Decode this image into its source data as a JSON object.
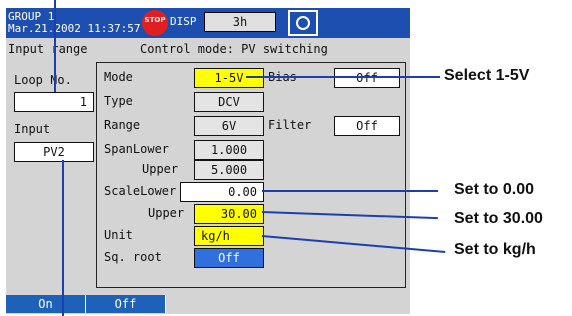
{
  "header": {
    "group": "GROUP 1",
    "datetime": "Mar.21.2002 11:37:57",
    "stop_label": "STOP",
    "disp_label": "DISP",
    "time_span": "3h"
  },
  "page": {
    "title": "Input range",
    "mode_text": "Control mode: PV switching"
  },
  "left_panel": {
    "loop_label": "Loop No.",
    "loop_value": "1",
    "input_label": "Input",
    "input_value": "PV2"
  },
  "fields": {
    "mode_label": "Mode",
    "mode_value": "1-5V",
    "bias_label": "Bias",
    "bias_value": "Off",
    "type_label": "Type",
    "type_value": "DCV",
    "range_label": "Range",
    "range_value": "6V",
    "filter_label": "Filter",
    "filter_value": "Off",
    "span_lower_label": "SpanLower",
    "span_lower_value": "1.000",
    "span_upper_label": "Upper",
    "span_upper_value": "5.000",
    "scale_lower_label": "ScaleLower",
    "scale_lower_value": "0.00",
    "scale_upper_label": "Upper",
    "scale_upper_value": "30.00",
    "unit_label": "Unit",
    "unit_value": "kg/h",
    "sq_root_label": "Sq. root",
    "sq_root_value": "Off"
  },
  "softkeys": {
    "on": "On",
    "off": "Off"
  },
  "callouts": {
    "select": "Select 1-5V",
    "set_lower": "Set to 0.00",
    "set_upper": "Set to 30.00",
    "set_unit": "Set to kg/h"
  },
  "colors": {
    "title_bar": "#1d4fb0",
    "highlight": "#ffff00",
    "selected": "#2f6fde",
    "callout_line": "#1d3fae"
  }
}
